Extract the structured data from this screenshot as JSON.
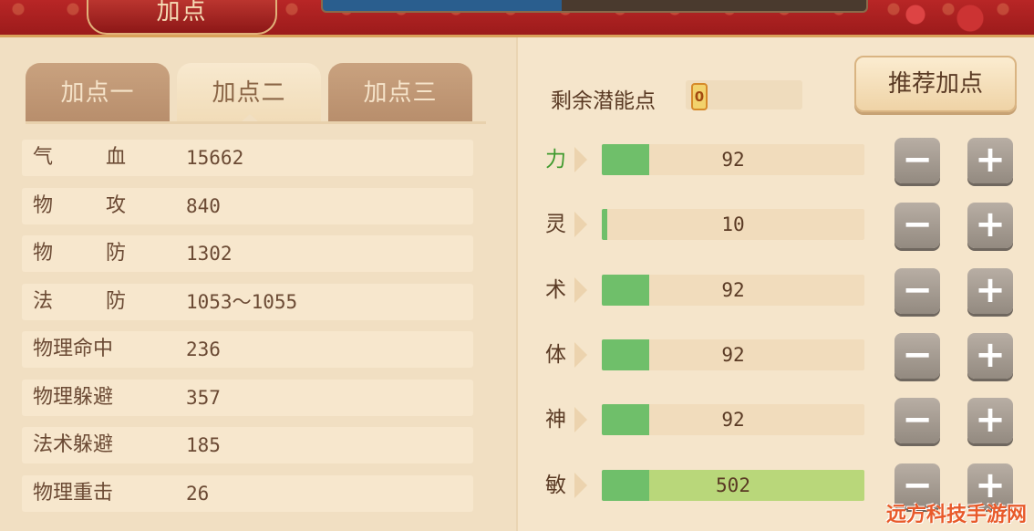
{
  "header": {
    "title": "加点"
  },
  "tabs": [
    {
      "label": "加点一",
      "active": false
    },
    {
      "label": "加点二",
      "active": true
    },
    {
      "label": "加点三",
      "active": false
    }
  ],
  "stats": [
    {
      "label": "气",
      "label2": "血",
      "value": "15662"
    },
    {
      "label": "物",
      "label2": "攻",
      "value": "840"
    },
    {
      "label": "物",
      "label2": "防",
      "value": "1302"
    },
    {
      "label": "法",
      "label2": "防",
      "value": "1053～1055"
    },
    {
      "label": "物理命中",
      "label2": "",
      "value": "236"
    },
    {
      "label": "物理躲避",
      "label2": "",
      "value": "357"
    },
    {
      "label": "法术躲避",
      "label2": "",
      "value": "185"
    },
    {
      "label": "物理重击",
      "label2": "",
      "value": "26"
    }
  ],
  "potential": {
    "label": "剩余潜能点",
    "value": "0"
  },
  "recommend_button": "推荐加点",
  "attributes": [
    {
      "name": "力",
      "value": "92",
      "base_fraction": 0.18,
      "extra_fraction": 0,
      "highlight": true
    },
    {
      "name": "灵",
      "value": "10",
      "base_fraction": 0.02,
      "extra_fraction": 0,
      "highlight": false
    },
    {
      "name": "术",
      "value": "92",
      "base_fraction": 0.18,
      "extra_fraction": 0,
      "highlight": false
    },
    {
      "name": "体",
      "value": "92",
      "base_fraction": 0.18,
      "extra_fraction": 0,
      "highlight": false
    },
    {
      "name": "神",
      "value": "92",
      "base_fraction": 0.18,
      "extra_fraction": 0,
      "highlight": false
    },
    {
      "name": "敏",
      "value": "502",
      "base_fraction": 0.18,
      "extra_fraction": 0.82,
      "highlight": false
    }
  ],
  "controls": {
    "minus": "−",
    "plus": "+"
  },
  "watermark": "远方科技手游网",
  "colors": {
    "banner": "#b82626",
    "bar_base": "#6fbf6a",
    "bar_extra": "#b9d77a",
    "highlight_text": "#3f9a2e"
  }
}
